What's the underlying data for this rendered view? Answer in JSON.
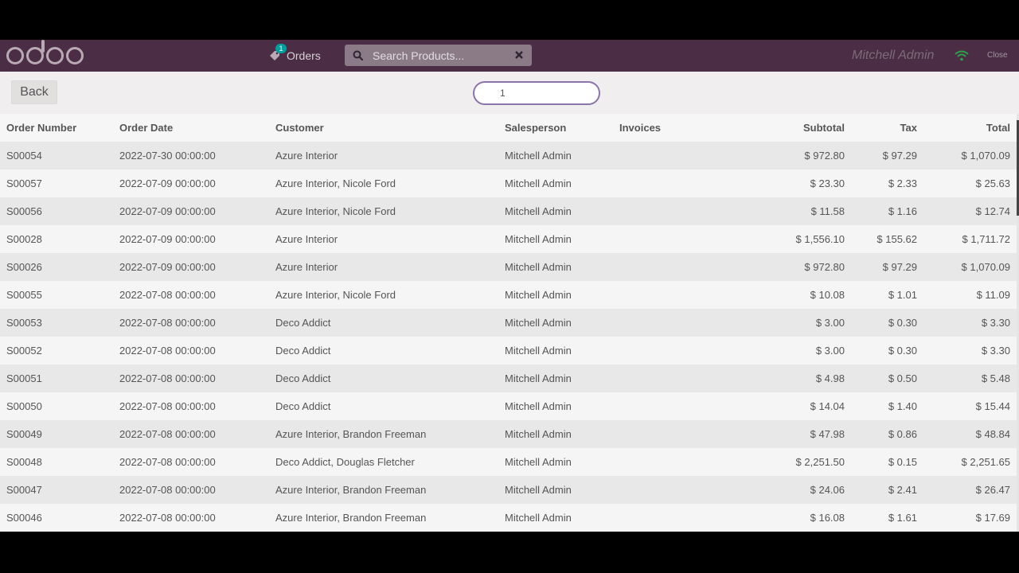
{
  "header": {
    "orders_label": "Orders",
    "orders_badge": "1",
    "search_placeholder": "Search Products...",
    "username": "Mitchell Admin",
    "close_label": "Close",
    "accent_color": "#4b2d45"
  },
  "controls": {
    "back_label": "Back",
    "filter_value": "1"
  },
  "table": {
    "columns": [
      "Order Number",
      "Order Date",
      "Customer",
      "Salesperson",
      "Invoices",
      "Subtotal",
      "Tax",
      "Total"
    ],
    "rows": [
      [
        "S00054",
        "2022-07-30 00:00:00",
        "Azure Interior",
        "Mitchell Admin",
        "",
        "$ 972.80",
        "$ 97.29",
        "$ 1,070.09"
      ],
      [
        "S00057",
        "2022-07-09 00:00:00",
        "Azure Interior, Nicole Ford",
        "Mitchell Admin",
        "",
        "$ 23.30",
        "$ 2.33",
        "$ 25.63"
      ],
      [
        "S00056",
        "2022-07-09 00:00:00",
        "Azure Interior, Nicole Ford",
        "Mitchell Admin",
        "",
        "$ 11.58",
        "$ 1.16",
        "$ 12.74"
      ],
      [
        "S00028",
        "2022-07-09 00:00:00",
        "Azure Interior",
        "Mitchell Admin",
        "",
        "$ 1,556.10",
        "$ 155.62",
        "$ 1,711.72"
      ],
      [
        "S00026",
        "2022-07-09 00:00:00",
        "Azure Interior",
        "Mitchell Admin",
        "",
        "$ 972.80",
        "$ 97.29",
        "$ 1,070.09"
      ],
      [
        "S00055",
        "2022-07-08 00:00:00",
        "Azure Interior, Nicole Ford",
        "Mitchell Admin",
        "",
        "$ 10.08",
        "$ 1.01",
        "$ 11.09"
      ],
      [
        "S00053",
        "2022-07-08 00:00:00",
        "Deco Addict",
        "Mitchell Admin",
        "",
        "$ 3.00",
        "$ 0.30",
        "$ 3.30"
      ],
      [
        "S00052",
        "2022-07-08 00:00:00",
        "Deco Addict",
        "Mitchell Admin",
        "",
        "$ 3.00",
        "$ 0.30",
        "$ 3.30"
      ],
      [
        "S00051",
        "2022-07-08 00:00:00",
        "Deco Addict",
        "Mitchell Admin",
        "",
        "$ 4.98",
        "$ 0.50",
        "$ 5.48"
      ],
      [
        "S00050",
        "2022-07-08 00:00:00",
        "Deco Addict",
        "Mitchell Admin",
        "",
        "$ 14.04",
        "$ 1.40",
        "$ 15.44"
      ],
      [
        "S00049",
        "2022-07-08 00:00:00",
        "Azure Interior, Brandon Freeman",
        "Mitchell Admin",
        "",
        "$ 47.98",
        "$ 0.86",
        "$ 48.84"
      ],
      [
        "S00048",
        "2022-07-08 00:00:00",
        "Deco Addict, Douglas Fletcher",
        "Mitchell Admin",
        "",
        "$ 2,251.50",
        "$ 0.15",
        "$ 2,251.65"
      ],
      [
        "S00047",
        "2022-07-08 00:00:00",
        "Azure Interior, Brandon Freeman",
        "Mitchell Admin",
        "",
        "$ 24.06",
        "$ 2.41",
        "$ 26.47"
      ],
      [
        "S00046",
        "2022-07-08 00:00:00",
        "Azure Interior, Brandon Freeman",
        "Mitchell Admin",
        "",
        "$ 16.08",
        "$ 1.61",
        "$ 17.69"
      ]
    ]
  }
}
